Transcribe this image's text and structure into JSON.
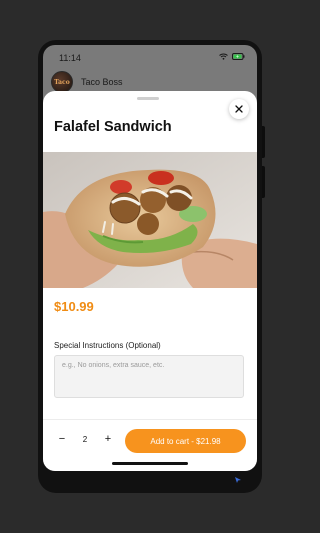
{
  "status_bar": {
    "time": "11:14",
    "icons": [
      "wifi-icon",
      "battery-charging-icon"
    ]
  },
  "background": {
    "restaurant_name": "Taco Boss",
    "avatar_text": "Taco"
  },
  "sheet": {
    "item_name": "Falafel Sandwich",
    "price": "$10.99",
    "image_alt": "falafel pita sandwich",
    "special_instructions": {
      "label": "Special Instructions (Optional)",
      "placeholder": "e.g., No onions, extra sauce, etc.",
      "value": ""
    },
    "quantity": {
      "decrement_label": "−",
      "value": "2",
      "increment_label": "+"
    },
    "add_to_cart_label": "Add to cart - $21.98"
  },
  "colors": {
    "accent": "#f7931e",
    "price": "#f08c14",
    "dim_background": "#7a7a7a",
    "page_background": "#2b2b2b"
  }
}
